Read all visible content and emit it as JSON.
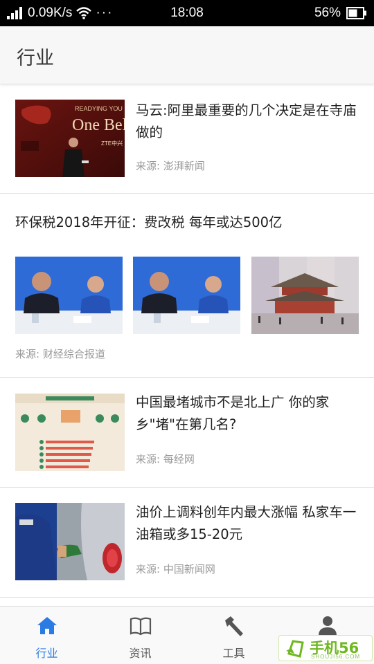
{
  "status_bar": {
    "network_speed": "0.09K/s",
    "dots": "···",
    "time": "18:08",
    "battery": "56%",
    "icons": [
      "signal-icon",
      "wifi-icon",
      "battery-icon"
    ]
  },
  "header": {
    "title": "行业"
  },
  "feed": {
    "items": [
      {
        "title": "马云:阿里最重要的几个决定是在寺庙做的",
        "source": "来源:  澎湃新闻"
      },
      {
        "title": "环保税2018年开征：费改税 每年或达500亿",
        "source": "来源:  财经综合报道"
      },
      {
        "title": "中国最堵城市不是北上广 你的家乡\"堵\"在第几名?",
        "source": "来源:  每经网"
      },
      {
        "title": "油价上调料创年内最大涨幅 私家车一油箱或多15-20元",
        "source": "来源:  中国新闻网"
      }
    ]
  },
  "images": {
    "thumb1_banner_text": "READYING YOU",
    "thumb1_big_text": "One Bel",
    "thumb1_brand": "ZTE中兴"
  },
  "bottom_nav": {
    "items": [
      {
        "label": "行业",
        "icon": "home-icon",
        "active": true
      },
      {
        "label": "资讯",
        "icon": "book-icon",
        "active": false
      },
      {
        "label": "工具",
        "icon": "hammer-icon",
        "active": false
      },
      {
        "label": "",
        "icon": "person-icon",
        "active": false
      }
    ]
  },
  "watermark": {
    "text": "手机56",
    "sub": "SHOUJI56.COM"
  },
  "colors": {
    "accent": "#2b7be3",
    "text": "#222222",
    "muted": "#999999",
    "watermark": "#6fb81f"
  }
}
